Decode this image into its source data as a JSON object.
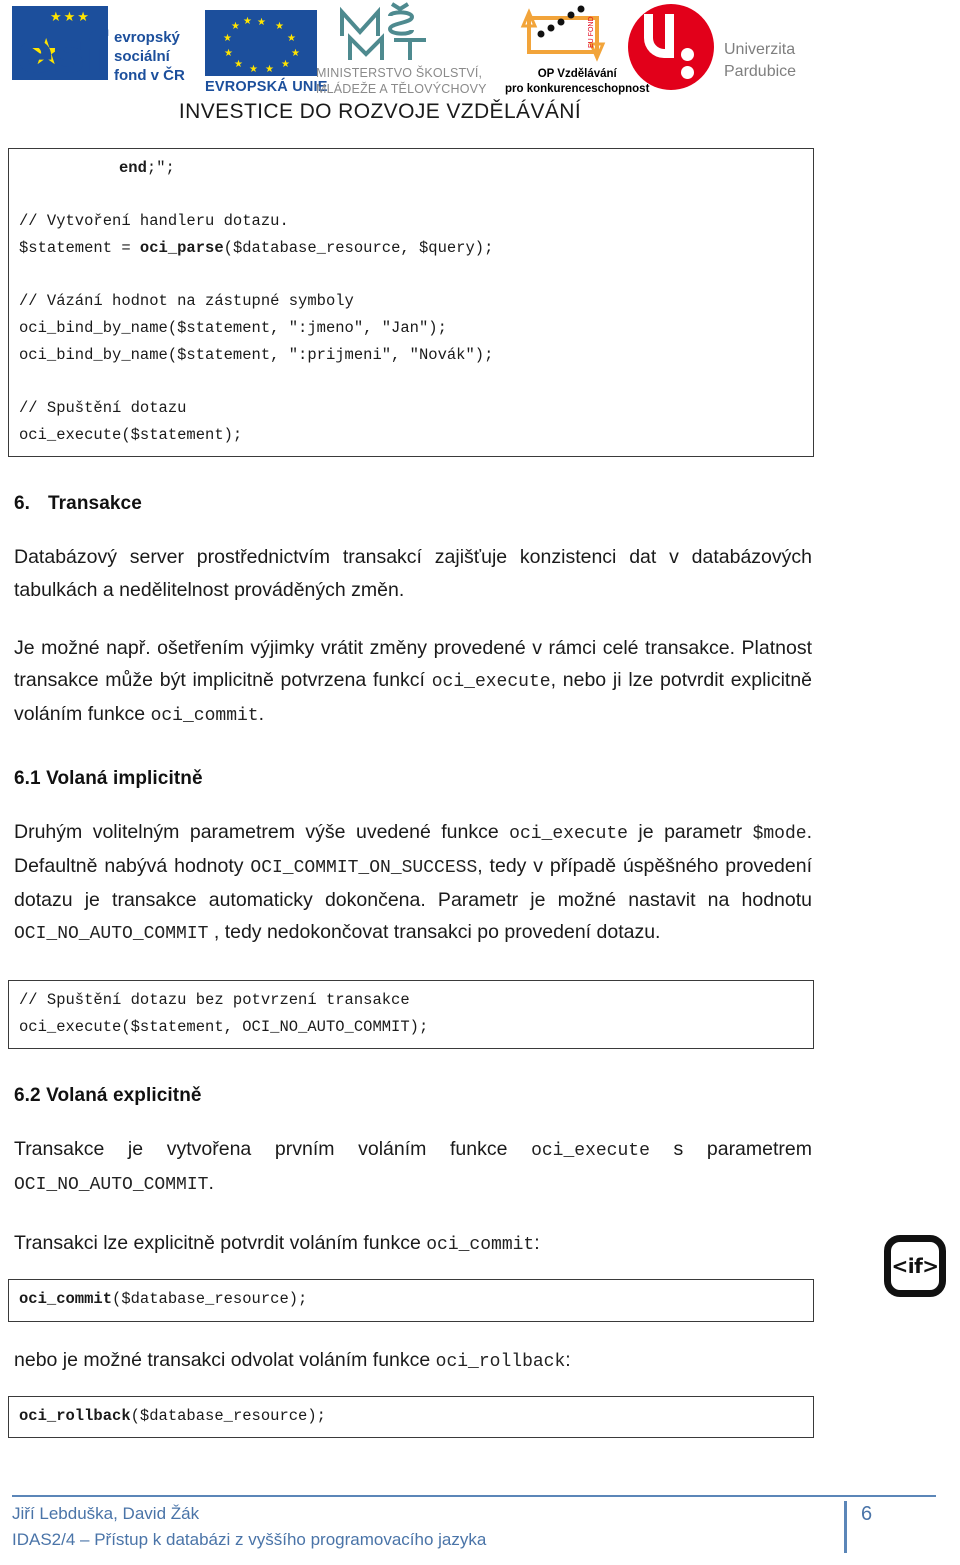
{
  "header": {
    "logos": [
      {
        "name": "esf-logo",
        "letters": "esf",
        "caption": "evropský\nsociální\nfond v ČR"
      },
      {
        "name": "eu-flag-logo",
        "caption": "EVROPSKÁ UNIE"
      },
      {
        "name": "msmt-logo",
        "mark": "MŠMT",
        "caption": "MINISTERSTVO ŠKOLSTVÍ,\nMLÁDEŽE A TĚLOVÝCHOVY"
      },
      {
        "name": "op-vzdelavani-logo",
        "caption": "OP Vzdělávání\npro konkurenceschopnost"
      },
      {
        "name": "univerzita-pardubice-logo",
        "caption": "Univerzita\nPardubice"
      }
    ],
    "tagline": "INVESTICE DO ROZVOJE VZDĚLÁVÁNÍ"
  },
  "content": {
    "code_block_1": {
      "bold_1": "end",
      "rest_1": ";\";",
      "line_blank_1": "",
      "line_2": "// Vytvoření handleru dotazu.",
      "line_3_pre": "$statement = ",
      "line_3_bold": "oci_parse",
      "line_3_post": "($database_resource, $query);",
      "line_blank_2": "",
      "line_4": "// Vázání hodnot na zástupné symboly",
      "line_5": "oci_bind_by_name($statement, \":jmeno\", \"Jan\");",
      "line_6": "oci_bind_by_name($statement, \":prijmeni\", \"Novák\");",
      "line_blank_3": "",
      "line_7": "// Spuštění dotazu",
      "line_8": "oci_execute($statement);"
    },
    "section_6": {
      "number": "6.",
      "title": "Transakce",
      "para_1": "Databázový server prostřednictvím transakcí zajišťuje konzistenci dat v databázových tabulkách a nedělitelnost prováděných změn.",
      "para_2_a": "Je možné např. ošetřením výjimky vrátit změny provedené v rámci celé transakce. Platnost transakce může být implicitně potvrzena funkcí ",
      "para_2_code1": "oci_execute",
      "para_2_b": ", nebo ji lze potvrdit explicitně voláním funkce ",
      "para_2_code2": "oci_commit",
      "para_2_c": "."
    },
    "section_6_1": {
      "title": "6.1 Volaná implicitně",
      "para_a": "Druhým volitelným parametrem výše uvedené funkce ",
      "code_1": "oci_execute",
      "para_b": " je parametr ",
      "code_2": "$mode",
      "para_c": ". Defaultně nabývá hodnoty ",
      "code_3": "OCI_COMMIT_ON_SUCCESS",
      "para_d": ", tedy v případě úspěšného provedení dotazu je transakce automaticky dokončena. Parametr je možné nastavit na hodnotu ",
      "code_4": "OCI_NO_AUTO_COMMIT",
      "para_e": " , tedy nedokončovat transakci po provedení dotazu."
    },
    "code_block_2": {
      "line_1": "// Spuštění dotazu bez potvrzení transakce",
      "line_2": "oci_execute($statement, OCI_NO_AUTO_COMMIT);"
    },
    "section_6_2": {
      "title": "6.2 Volaná explicitně",
      "para_a": "Transakce je vytvořena prvním voláním funkce ",
      "code_1": "oci_execute",
      "para_b": " s parametrem ",
      "code_2": "OCI_NO_AUTO_COMMIT",
      "para_c": ".",
      "para_commit_a": "Transakci lze explicitně potvrdit voláním funkce ",
      "para_commit_code": "oci_commit",
      "para_commit_b": ":",
      "para_rollback_a": "nebo je možné transakci odvolat voláním funkce ",
      "para_rollback_code": "oci_rollback",
      "para_rollback_b": ":"
    },
    "code_block_3": {
      "bold": "oci_commit",
      "rest": "($database_resource);"
    },
    "code_block_4": {
      "bold": "oci_rollback",
      "rest": "($database_resource);"
    },
    "if_badge": "<if>"
  },
  "footer": {
    "authors": "Jiří Lebduška, David Žák\nIDAS2/4 – Přístup k databázi z vyššího programovacího jazyka",
    "page_number": "6"
  }
}
